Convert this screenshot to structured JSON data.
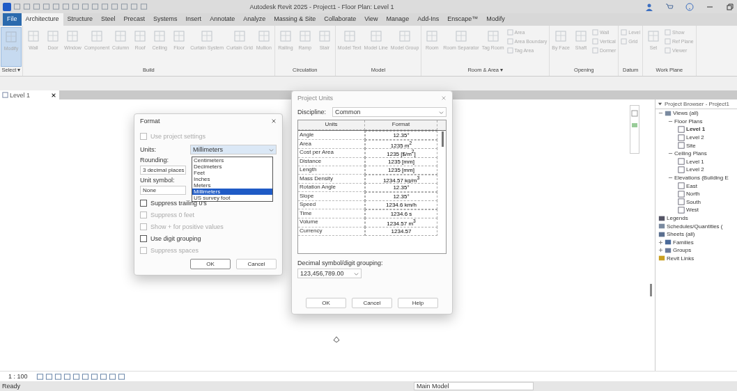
{
  "window": {
    "title": "Autodesk Revit 2025 - Project1 - Floor Plan: Level 1"
  },
  "ribbon_tabs": [
    {
      "label": "File",
      "kind": "file",
      "selected": false
    },
    {
      "label": "Architecture",
      "kind": "tab",
      "selected": true
    },
    {
      "label": "Structure",
      "kind": "tab",
      "selected": false
    },
    {
      "label": "Steel",
      "kind": "tab",
      "selected": false
    },
    {
      "label": "Precast",
      "kind": "tab",
      "selected": false
    },
    {
      "label": "Systems",
      "kind": "tab",
      "selected": false
    },
    {
      "label": "Insert",
      "kind": "tab",
      "selected": false
    },
    {
      "label": "Annotate",
      "kind": "tab",
      "selected": false
    },
    {
      "label": "Analyze",
      "kind": "tab",
      "selected": false
    },
    {
      "label": "Massing & Site",
      "kind": "tab",
      "selected": false
    },
    {
      "label": "Collaborate",
      "kind": "tab",
      "selected": false
    },
    {
      "label": "View",
      "kind": "tab",
      "selected": false
    },
    {
      "label": "Manage",
      "kind": "tab",
      "selected": false
    },
    {
      "label": "Add-Ins",
      "kind": "tab",
      "selected": false
    },
    {
      "label": "Enscape™",
      "kind": "tab",
      "selected": false
    },
    {
      "label": "Modify",
      "kind": "tab",
      "selected": false
    }
  ],
  "ribbon": {
    "disabled": true,
    "groups": [
      {
        "label": "Select ▾",
        "tools": [
          {
            "kind": "large",
            "label": "Modify",
            "active": true
          }
        ]
      },
      {
        "label": "Build",
        "tools": [
          {
            "kind": "large",
            "label": "Wall",
            "active": false
          },
          {
            "kind": "large",
            "label": "Door",
            "active": false
          },
          {
            "kind": "large",
            "label": "Window",
            "active": false
          },
          {
            "kind": "large",
            "label": "Component",
            "active": false
          },
          {
            "kind": "large",
            "label": "Column",
            "active": false
          },
          {
            "kind": "large",
            "label": "Roof",
            "active": false
          },
          {
            "kind": "large",
            "label": "Ceiling",
            "active": false
          },
          {
            "kind": "large",
            "label": "Floor",
            "active": false
          },
          {
            "kind": "large",
            "label": "Curtain System",
            "active": false
          },
          {
            "kind": "large",
            "label": "Curtain Grid",
            "active": false
          },
          {
            "kind": "large",
            "label": "Mullion",
            "active": false
          }
        ]
      },
      {
        "label": "Circulation",
        "tools": [
          {
            "kind": "large",
            "label": "Railing",
            "active": false
          },
          {
            "kind": "large",
            "label": "Ramp",
            "active": false
          },
          {
            "kind": "large",
            "label": "Stair",
            "active": false
          }
        ]
      },
      {
        "label": "Model",
        "tools": [
          {
            "kind": "large",
            "label": "Model Text",
            "active": false
          },
          {
            "kind": "large",
            "label": "Model Line",
            "active": false
          },
          {
            "kind": "large",
            "label": "Model Group",
            "active": false
          }
        ]
      },
      {
        "label": "Room & Area ▾",
        "tools": [
          {
            "kind": "large",
            "label": "Room",
            "active": false
          },
          {
            "kind": "large",
            "label": "Room Separator",
            "active": false
          },
          {
            "kind": "large",
            "label": "Tag Room",
            "active": false
          },
          {
            "kind": "stack",
            "items": [
              "Area",
              "Area Boundary",
              "Tag Area"
            ]
          }
        ]
      },
      {
        "label": "Opening",
        "tools": [
          {
            "kind": "large",
            "label": "By Face",
            "active": false
          },
          {
            "kind": "large",
            "label": "Shaft",
            "active": false
          },
          {
            "kind": "stack",
            "items": [
              "Wall",
              "Vertical",
              "Dormer"
            ]
          }
        ]
      },
      {
        "label": "Datum",
        "tools": [
          {
            "kind": "stack",
            "items": [
              "Level",
              "Grid"
            ]
          }
        ]
      },
      {
        "label": "Work Plane",
        "tools": [
          {
            "kind": "large",
            "label": "Set",
            "active": false
          },
          {
            "kind": "stack",
            "items": [
              "Show",
              "Ref Plane",
              "Viewer"
            ]
          }
        ]
      }
    ]
  },
  "view_tabs": [
    {
      "label": "Level 1",
      "selected": true
    }
  ],
  "format_dialog": {
    "title": "Format",
    "use_project": {
      "label": "Use project settings",
      "checked": false,
      "disabled": true
    },
    "units_label": "Units:",
    "units_value": "Millimeters",
    "options": [
      {
        "label": "Centimeters",
        "selected": false
      },
      {
        "label": "Decimeters",
        "selected": false
      },
      {
        "label": "Feet",
        "selected": false
      },
      {
        "label": "Inches",
        "selected": false
      },
      {
        "label": "Meters",
        "selected": false
      },
      {
        "label": "Millimeters",
        "selected": true
      },
      {
        "label": "US survey foot",
        "selected": false
      }
    ],
    "rounding_label": "Rounding:",
    "rounding_value": "3 decimal places",
    "symbol_label": "Unit symbol:",
    "symbol_value": "None",
    "checkboxes": [
      {
        "label": "Suppress trailing 0's",
        "checked": false,
        "disabled": false
      },
      {
        "label": "Suppress 0 feet",
        "checked": false,
        "disabled": true
      },
      {
        "label": "Show + for positive values",
        "checked": false,
        "disabled": true
      },
      {
        "label": "Use digit grouping",
        "checked": false,
        "disabled": false
      },
      {
        "label": "Suppress spaces",
        "checked": false,
        "disabled": true
      }
    ],
    "buttons": [
      "OK",
      "Cancel"
    ]
  },
  "units_dialog": {
    "title": "Project Units",
    "discipline_label": "Discipline:",
    "discipline_value": "Common",
    "columns": [
      "Units",
      "Format"
    ],
    "rows": [
      {
        "unit": "Angle",
        "format": "12.35°"
      },
      {
        "unit": "Area",
        "format": "1235 m$^{2}$"
      },
      {
        "unit": "Cost per Area",
        "format": "1235 [$/m$^{2}$]"
      },
      {
        "unit": "Distance",
        "format": "1235 [mm]"
      },
      {
        "unit": "Length",
        "format": "1235 [mm]"
      },
      {
        "unit": "Mass Density",
        "format": "1234.57 kg/m$^{3}$"
      },
      {
        "unit": "Rotation Angle",
        "format": "12.35°"
      },
      {
        "unit": "Slope",
        "format": "12.35°"
      },
      {
        "unit": "Speed",
        "format": "1234.6 km/h"
      },
      {
        "unit": "Time",
        "format": "1234.6 s"
      },
      {
        "unit": "Volume",
        "format": "1234.57 m$^{3}$"
      },
      {
        "unit": "Currency",
        "format": "1234.57"
      }
    ],
    "decimal_label": "Decimal symbol/digit grouping:",
    "decimal_value": "123,456,789.00",
    "buttons": [
      "OK",
      "Cancel",
      "Help"
    ]
  },
  "project_browser": {
    "title": "Project Browser - Project1",
    "tree": [
      {
        "label": "Views (all)",
        "kind": "root",
        "expanded": true,
        "selected": false,
        "children": [
          {
            "label": "Floor Plans",
            "expanded": true,
            "selected": false,
            "children": [
              {
                "label": "Level 1",
                "kind": "view",
                "selected": true
              },
              {
                "label": "Level 2",
                "kind": "view",
                "selected": false
              },
              {
                "label": "Site",
                "kind": "view",
                "selected": false
              }
            ]
          },
          {
            "label": "Ceiling Plans",
            "expanded": true,
            "selected": false,
            "children": [
              {
                "label": "Level 1",
                "kind": "view",
                "selected": false
              },
              {
                "label": "Level 2",
                "kind": "view",
                "selected": false
              }
            ]
          },
          {
            "label": "Elevations (Building E",
            "expanded": true,
            "selected": false,
            "children": [
              {
                "label": "East",
                "kind": "view",
                "selected": false
              },
              {
                "label": "North",
                "kind": "view",
                "selected": false
              },
              {
                "label": "South",
                "kind": "view",
                "selected": false
              },
              {
                "label": "West",
                "kind": "view",
                "selected": false
              }
            ]
          }
        ]
      },
      {
        "label": "Legends",
        "kind": "legend",
        "selected": false
      },
      {
        "label": "Schedules/Quantities (",
        "kind": "schedule",
        "selected": false
      },
      {
        "label": "Sheets (all)",
        "kind": "sheet",
        "selected": false
      },
      {
        "label": "Families",
        "kind": "family",
        "expanded": false,
        "selected": false
      },
      {
        "label": "Groups",
        "kind": "group",
        "expanded": false,
        "selected": false
      },
      {
        "label": "Revit Links",
        "kind": "link",
        "selected": false
      }
    ]
  },
  "view_control": {
    "scale": "1 : 100"
  },
  "status_bar": {
    "text": "Ready",
    "workset": "Main Model"
  }
}
